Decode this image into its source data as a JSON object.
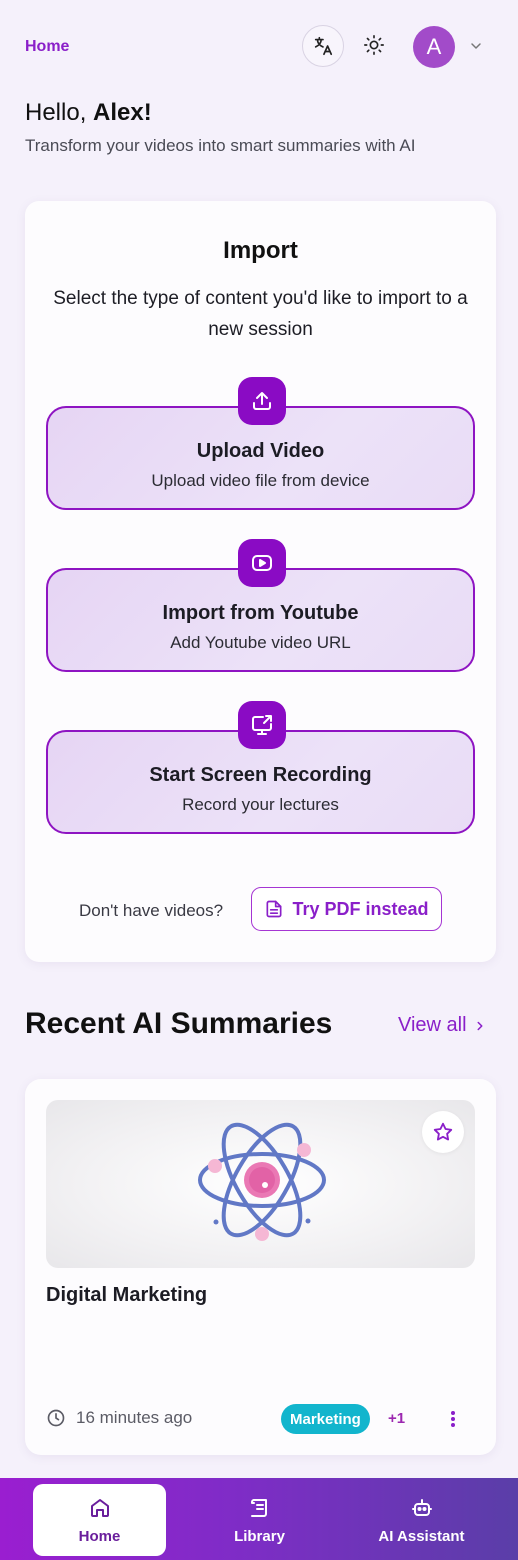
{
  "header": {
    "breadcrumb": "Home",
    "avatar_initial": "A"
  },
  "greeting": {
    "hello": "Hello,",
    "name": "Alex!",
    "subtitle": "Transform your videos into smart summaries with AI"
  },
  "import": {
    "title": "Import",
    "description": "Select the type of content you'd like to import to a new session",
    "options": [
      {
        "title": "Upload Video",
        "subtitle": "Upload video file from device",
        "icon": "upload-icon"
      },
      {
        "title": "Import from Youtube",
        "subtitle": "Add Youtube video URL",
        "icon": "youtube-icon"
      },
      {
        "title": "Start Screen Recording",
        "subtitle": "Record your lectures",
        "icon": "screen-record-icon"
      }
    ],
    "no_videos_text": "Don't have videos?",
    "pdf_button": "Try PDF instead"
  },
  "recent": {
    "title": "Recent AI Summaries",
    "view_all": "View all",
    "items": [
      {
        "title": "Digital Marketing",
        "time": "16 minutes ago",
        "tag": "Marketing",
        "extra_tags": "+1"
      }
    ]
  },
  "nav": {
    "items": [
      {
        "label": "Home",
        "icon": "home-icon"
      },
      {
        "label": "Library",
        "icon": "library-icon"
      },
      {
        "label": "AI Assistant",
        "icon": "robot-icon"
      }
    ]
  },
  "colors": {
    "accent": "#8a0bc4",
    "tag": "#12b5cd",
    "background": "#f5f1fb"
  }
}
